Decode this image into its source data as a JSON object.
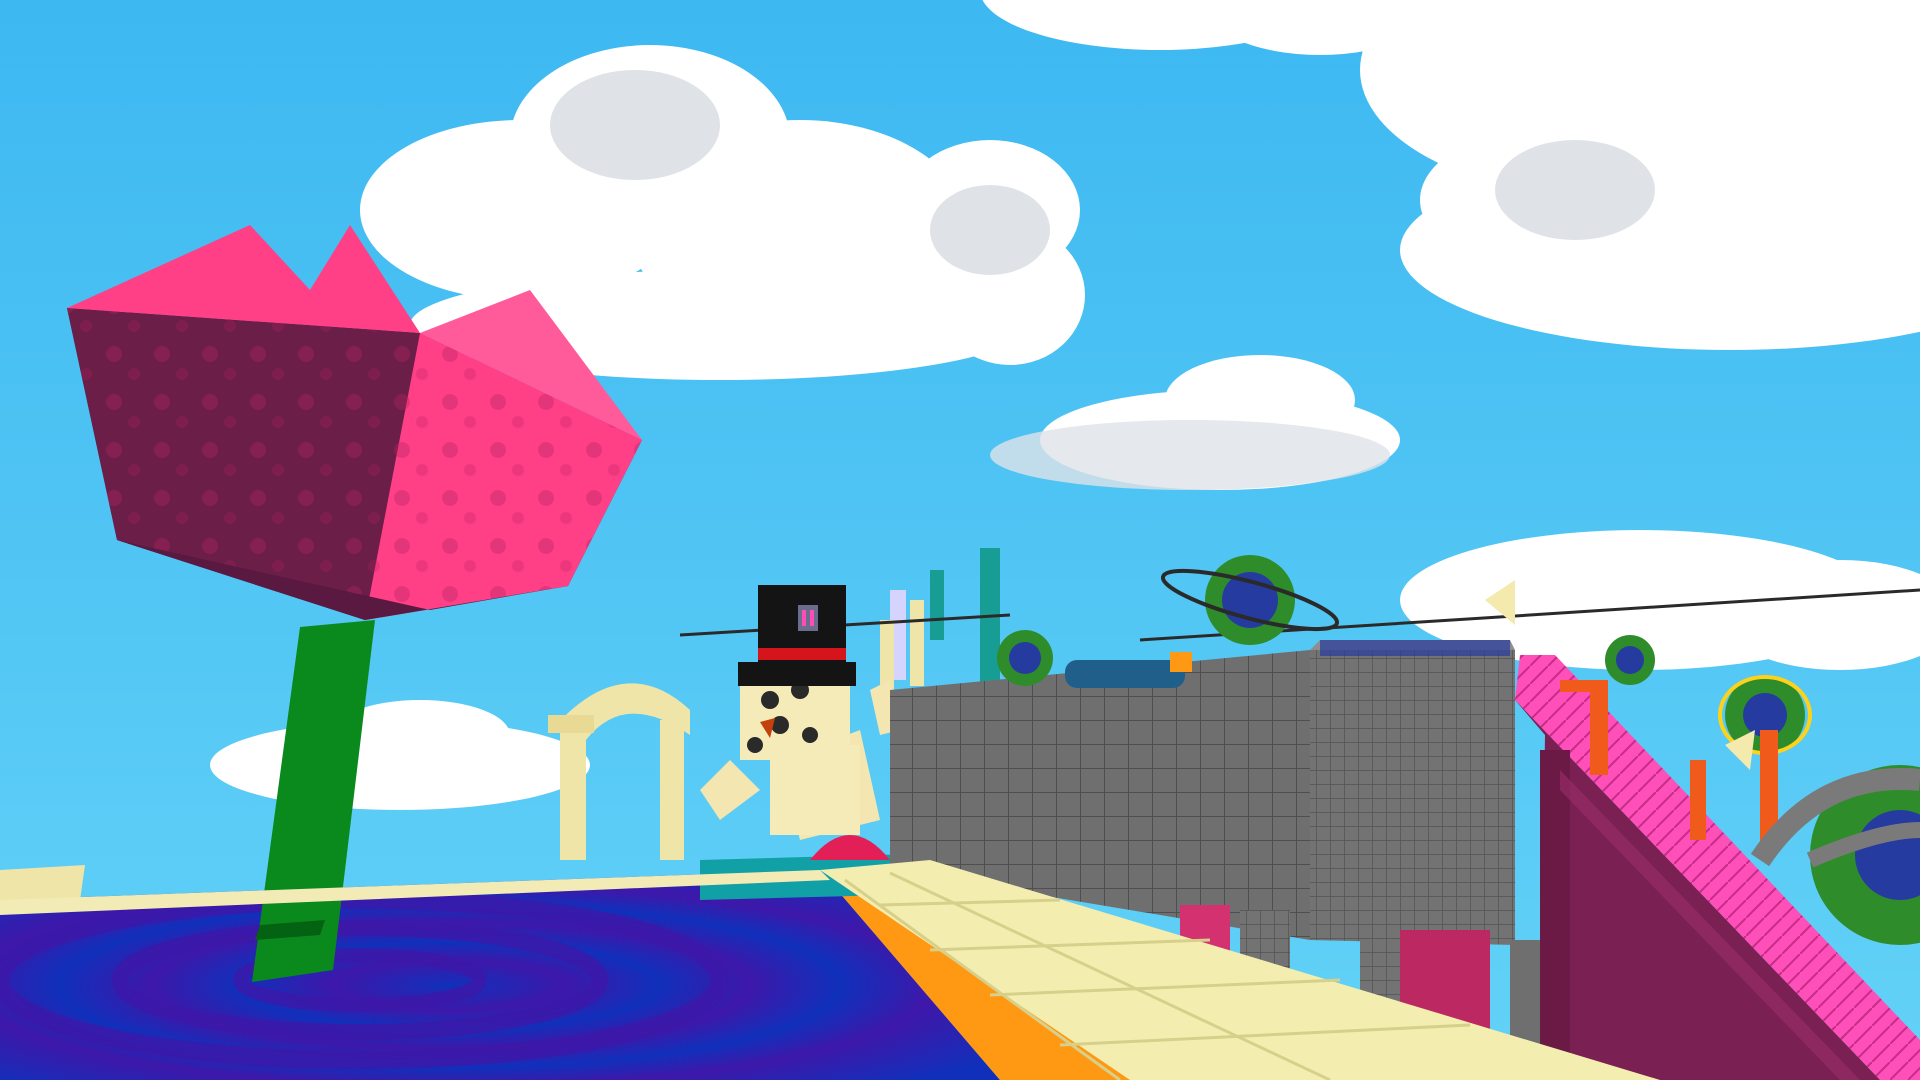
{
  "game": {
    "view": "third-person-3d-world",
    "hud_text": []
  },
  "scene": {
    "sky_color": "#56c8f5",
    "sky_top_color": "#3cb6f0",
    "cloud_color": "#ffffff",
    "cloud_shadow_color": "#d7d9df",
    "flower_petal_color": "#ff3f86",
    "flower_petal_dark_color": "#6b1e47",
    "flower_stem_color": "#0a8a1c",
    "water_color": "#1130b7",
    "water_ring_color": "#3d18a9",
    "path_color": "#f3eeb0",
    "path_edge_color": "#ff9812",
    "wall_color": "#6d6d6d",
    "wall_grid_color": "#4e4e4e",
    "ramp_color": "#ff52ba",
    "ramp_dark_color": "#7b2052",
    "snowman_body_color": "#f5ebb8",
    "hat_color": "#111111",
    "hat_band_color": "#d5141b",
    "planet_green_color": "#2f8c2b",
    "planet_blue_color": "#263b9f",
    "arch_color": "#efe5a8"
  },
  "objects": [
    {
      "name": "giant-tulip",
      "icon": "flower-icon"
    },
    {
      "name": "snowman-with-top-hat",
      "icon": "snowman-icon"
    },
    {
      "name": "grid-wall",
      "icon": "wall-icon"
    },
    {
      "name": "pink-ramp",
      "icon": "ramp-icon"
    },
    {
      "name": "swirl-pool",
      "icon": "water-icon"
    },
    {
      "name": "floating-planets",
      "icon": "planet-icon"
    },
    {
      "name": "stone-arch",
      "icon": "arch-icon"
    }
  ]
}
